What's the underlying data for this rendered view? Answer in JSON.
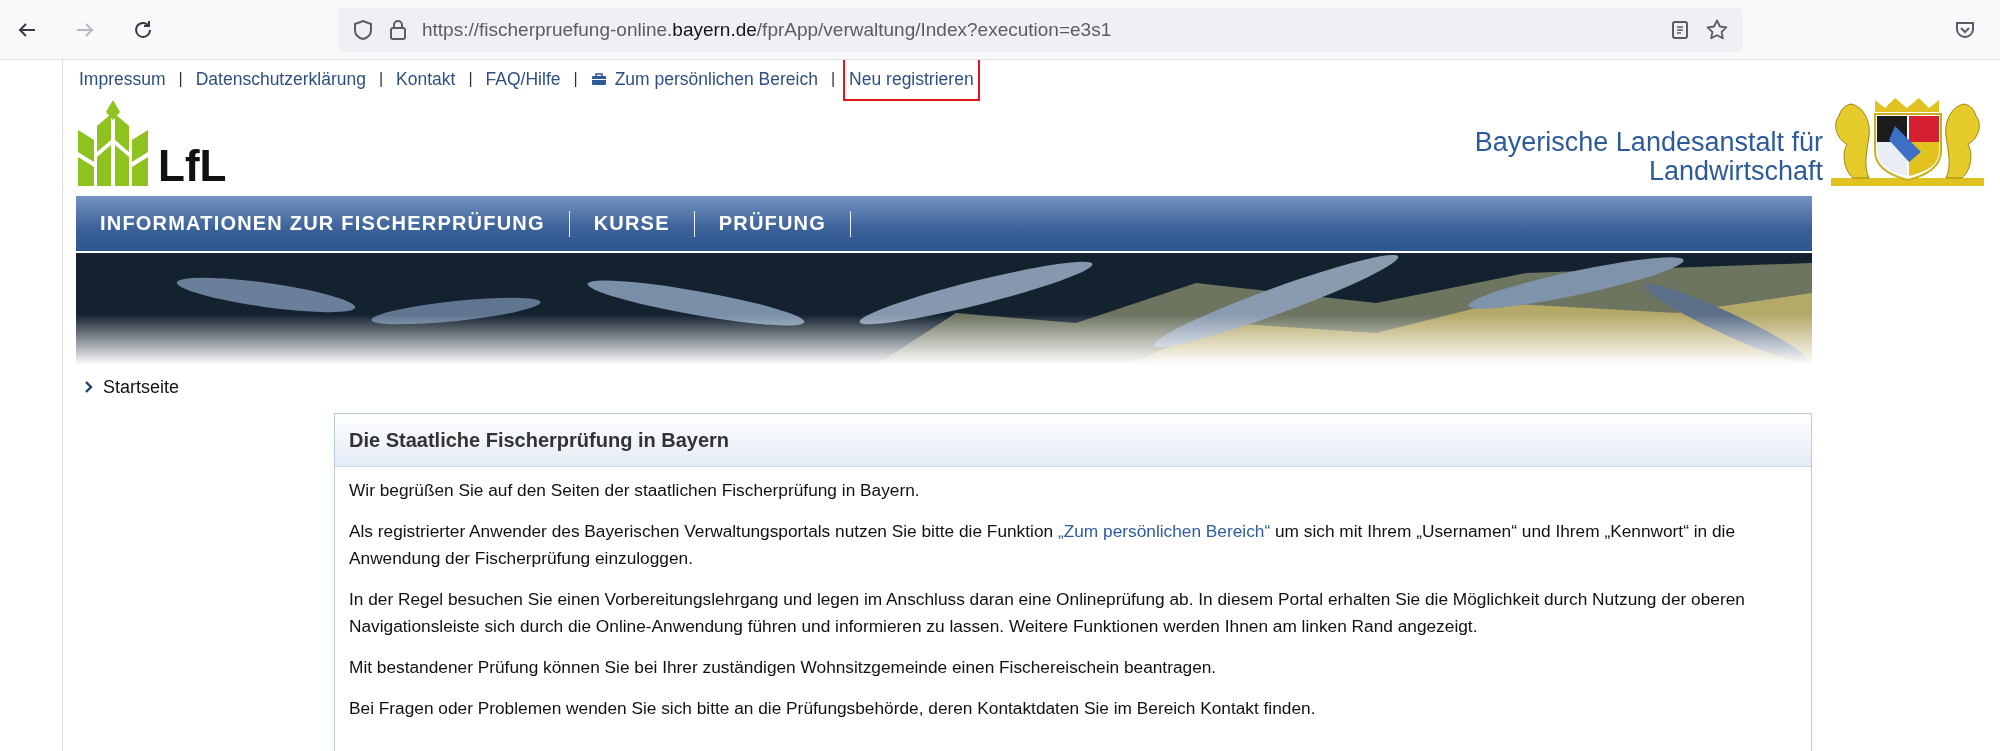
{
  "browser": {
    "nav_buttons": [
      {
        "kind": "back",
        "disabled": false
      },
      {
        "kind": "forward",
        "disabled": true
      },
      {
        "kind": "reload",
        "disabled": false
      }
    ],
    "url_parts": [
      {
        "text": "https://fischerpruefung-online.",
        "kind": "dim"
      },
      {
        "text": "bayern.de",
        "kind": "host"
      },
      {
        "text": "/fprApp/verwaltung/Index?execution=e3s1",
        "kind": "dim"
      }
    ]
  },
  "top_links": [
    {
      "label": "Impressum",
      "separator": "|",
      "highlighted": false,
      "kind": "plain"
    },
    {
      "label": "Datenschutzerklärung",
      "separator": "|",
      "highlighted": false,
      "kind": "plain"
    },
    {
      "label": "Kontakt",
      "separator": "|",
      "highlighted": false,
      "kind": "plain"
    },
    {
      "label": "FAQ/Hilfe",
      "separator": "|",
      "highlighted": false,
      "kind": "plain"
    },
    {
      "label": "Zum persönlichen Bereich",
      "separator": "|",
      "highlighted": false,
      "kind": "briefcase"
    },
    {
      "label": "Neu registrieren",
      "highlighted": true,
      "kind": "plain"
    }
  ],
  "logo": {
    "text": "LfL"
  },
  "institution": {
    "lines": [
      "Bayerische Landesanstalt für",
      "Landwirtschaft"
    ]
  },
  "nav": [
    {
      "label": "INFORMATIONEN ZUR FISCHERPRÜFUNG"
    },
    {
      "label": "KURSE"
    },
    {
      "label": "PRÜFUNG"
    }
  ],
  "breadcrumb": [
    {
      "label": "Startseite"
    }
  ],
  "article": {
    "title": "Die Staatliche Fischerprüfung in Bayern",
    "paragraphs": [
      [
        {
          "text": "Wir begrüßen Sie auf den Seiten der staatlichen Fischerprüfung in Bayern.",
          "kind": "text"
        }
      ],
      [
        {
          "text": "Als registrierter Anwender des Bayerischen Verwaltungsportals nutzen Sie bitte die Funktion ",
          "kind": "text"
        },
        {
          "text": "„Zum persönlichen Bereich“",
          "kind": "link"
        },
        {
          "text": " um sich mit Ihrem „Usernamen“ und Ihrem „Kennwort“ in die Anwendung der Fischerprüfung einzuloggen.",
          "kind": "text"
        }
      ],
      [
        {
          "text": "In der Regel besuchen Sie einen Vorbereitungslehrgang und legen im Anschluss daran eine Onlineprüfung ab. In diesem Portal erhalten Sie die Möglichkeit durch Nutzung der oberen Navigationsleiste sich durch die Online-Anwendung führen und informieren zu lassen. Weitere Funktionen werden Ihnen am linken Rand angezeigt.",
          "kind": "text"
        }
      ],
      [
        {
          "text": "Mit bestandener Prüfung können Sie bei Ihrer zuständigen Wohnsitzgemeinde einen Fischereischein beantragen.",
          "kind": "text"
        }
      ],
      [
        {
          "text": "Bei Fragen oder Problemen wenden Sie sich bitte an die Prüfungsbehörde, deren Kontaktdaten Sie im Bereich Kontakt finden.",
          "kind": "text"
        }
      ]
    ]
  }
}
